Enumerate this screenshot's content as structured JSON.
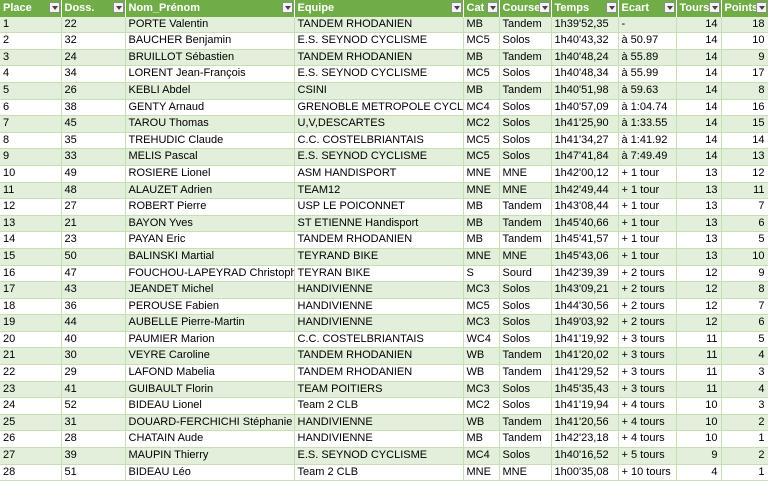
{
  "headers": [
    "Place",
    "Doss.",
    "Nom_Prénom",
    "Equipe",
    "Cat",
    "Course",
    "Temps",
    "Ecart",
    "Tours",
    "Points"
  ],
  "rows": [
    [
      "1",
      "22",
      "PORTE Valentin",
      "TANDEM RHODANIEN",
      "MB",
      "Tandem",
      "1h39'52,35",
      "-",
      "14",
      "18"
    ],
    [
      "2",
      "32",
      "BAUCHER Benjamin",
      "E.S. SEYNOD CYCLISME",
      "MC5",
      "Solos",
      "1h40'43,32",
      "à 50.97",
      "14",
      "10"
    ],
    [
      "3",
      "24",
      "BRUILLOT Sébastien",
      "TANDEM RHODANIEN",
      "MB",
      "Tandem",
      "1h40'48,24",
      "à 55.89",
      "14",
      "9"
    ],
    [
      "4",
      "34",
      "LORENT Jean-François",
      "E.S. SEYNOD CYCLISME",
      "MC5",
      "Solos",
      "1h40'48,34",
      "à 55.99",
      "14",
      "17"
    ],
    [
      "5",
      "26",
      "KEBLI Abdel",
      "CSINI",
      "MB",
      "Tandem",
      "1h40'51,98",
      "à 59.63",
      "14",
      "8"
    ],
    [
      "6",
      "38",
      "GENTY Arnaud",
      "GRENOBLE METROPOLE CYCLISM",
      "MC4",
      "Solos",
      "1h40'57,09",
      "à 1:04.74",
      "14",
      "16"
    ],
    [
      "7",
      "45",
      "TAROU Thomas",
      "U,V,DESCARTES",
      "MC2",
      "Solos",
      "1h41'25,90",
      "à 1:33.55",
      "14",
      "15"
    ],
    [
      "8",
      "35",
      "TREHUDIC Claude",
      "C.C. COSTELBRIANTAIS",
      "MC5",
      "Solos",
      "1h41'34,27",
      "à 1:41.92",
      "14",
      "14"
    ],
    [
      "9",
      "33",
      "MELIS Pascal",
      "E.S. SEYNOD CYCLISME",
      "MC5",
      "Solos",
      "1h47'41,84",
      "à 7:49.49",
      "14",
      "13"
    ],
    [
      "10",
      "49",
      "ROSIERE Lionel",
      "ASM HANDISPORT",
      "MNE",
      "MNE",
      "1h42'00,12",
      "+ 1 tour",
      "13",
      "12"
    ],
    [
      "11",
      "48",
      "ALAUZET Adrien",
      "TEAM12",
      "MNE",
      "MNE",
      "1h42'49,44",
      "+ 1 tour",
      "13",
      "11"
    ],
    [
      "12",
      "27",
      "ROBERT Pierre",
      "USP LE POICONNET",
      "MB",
      "Tandem",
      "1h43'08,44",
      "+ 1 tour",
      "13",
      "7"
    ],
    [
      "13",
      "21",
      "BAYON Yves",
      "ST ETIENNE Handisport",
      "MB",
      "Tandem",
      "1h45'40,66",
      "+ 1 tour",
      "13",
      "6"
    ],
    [
      "14",
      "23",
      "PAYAN Eric",
      "TANDEM RHODANIEN",
      "MB",
      "Tandem",
      "1h45'41,57",
      "+ 1 tour",
      "13",
      "5"
    ],
    [
      "15",
      "50",
      "BALINSKI Martial",
      "TEYRAND BIKE",
      "MNE",
      "MNE",
      "1h45'43,06",
      "+ 1 tour",
      "13",
      "10"
    ],
    [
      "16",
      "47",
      "FOUCHOU-LAPEYRAD Christophe",
      "TEYRAN BIKE",
      "S",
      "Sourd",
      "1h42'39,39",
      "+ 2 tours",
      "12",
      "9"
    ],
    [
      "17",
      "43",
      "JEANDET Michel",
      "HANDIVIENNE",
      "MC3",
      "Solos",
      "1h43'09,21",
      "+ 2 tours",
      "12",
      "8"
    ],
    [
      "18",
      "36",
      "PEROUSE Fabien",
      "HANDIVIENNE",
      "MC5",
      "Solos",
      "1h44'30,56",
      "+ 2 tours",
      "12",
      "7"
    ],
    [
      "19",
      "44",
      "AUBELLE Pierre-Martin",
      "HANDIVIENNE",
      "MC3",
      "Solos",
      "1h49'03,92",
      "+ 2 tours",
      "12",
      "6"
    ],
    [
      "20",
      "40",
      "PAUMIER Marion",
      "C.C. COSTELBRIANTAIS",
      "WC4",
      "Solos",
      "1h41'19,92",
      "+ 3 tours",
      "11",
      "5"
    ],
    [
      "21",
      "30",
      "VEYRE Caroline",
      "TANDEM RHODANIEN",
      "WB",
      "Tandem",
      "1h41'20,02",
      "+ 3 tours",
      "11",
      "4"
    ],
    [
      "22",
      "29",
      "LAFOND Mabelia",
      "TANDEM RHODANIEN",
      "WB",
      "Tandem",
      "1h41'29,52",
      "+ 3 tours",
      "11",
      "3"
    ],
    [
      "23",
      "41",
      "GUIBAULT Florin",
      "TEAM POITIERS",
      "MC3",
      "Solos",
      "1h45'35,43",
      "+ 3 tours",
      "11",
      "4"
    ],
    [
      "24",
      "52",
      "BIDEAU Lionel",
      "Team 2 CLB",
      "MC2",
      "Solos",
      "1h41'19,94",
      "+ 4 tours",
      "10",
      "3"
    ],
    [
      "25",
      "31",
      "DOUARD-FERCHICHI Stéphanie",
      "HANDIVIENNE",
      "WB",
      "Tandem",
      "1h41'20,56",
      "+ 4 tours",
      "10",
      "2"
    ],
    [
      "26",
      "28",
      "CHATAIN Aude",
      "HANDIVIENNE",
      "MB",
      "Tandem",
      "1h42'23,18",
      "+ 4 tours",
      "10",
      "1"
    ],
    [
      "27",
      "39",
      "MAUPIN Thierry",
      "E.S. SEYNOD CYCLISME",
      "MC4",
      "Solos",
      "1h40'16,52",
      "+ 5 tours",
      "9",
      "2"
    ],
    [
      "28",
      "51",
      "BIDEAU Léo",
      "Team 2 CLB",
      "MNE",
      "MNE",
      "1h00'35,08",
      "+ 10 tours",
      "4",
      "1"
    ]
  ]
}
